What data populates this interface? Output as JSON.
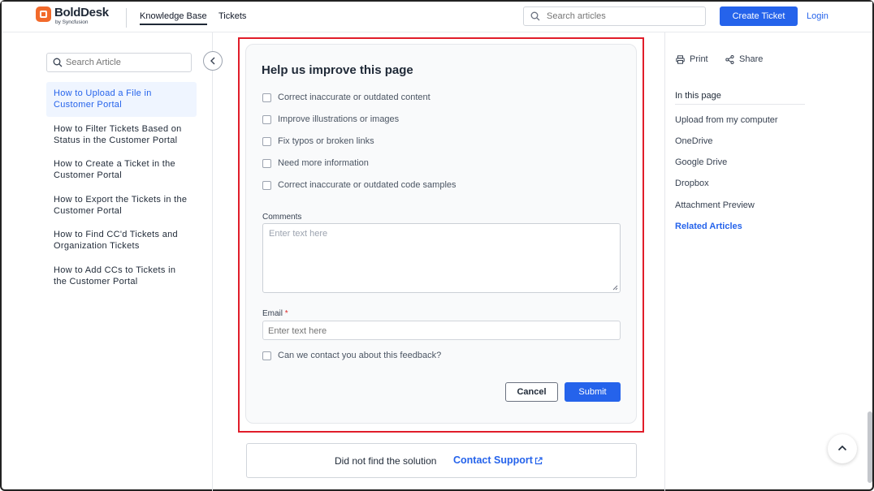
{
  "header": {
    "logo_text": "BoldDesk",
    "logo_subtext": "by Syncfusion",
    "nav": [
      {
        "label": "Knowledge Base",
        "active": true
      },
      {
        "label": "Tickets",
        "active": false
      }
    ],
    "search_placeholder": "Search articles",
    "create_ticket_label": "Create Ticket",
    "login_label": "Login"
  },
  "sidebar": {
    "search_placeholder": "Search Article",
    "items": [
      {
        "label": "How to Upload a File in Customer Portal",
        "active": true
      },
      {
        "label": "How to Filter Tickets Based on Status in the Customer Portal",
        "active": false
      },
      {
        "label": "How to Create a Ticket in the Customer Portal",
        "active": false
      },
      {
        "label": "How to Export the Tickets in the Customer Portal",
        "active": false
      },
      {
        "label": "How to Find CC'd Tickets and Organization Tickets",
        "active": false
      },
      {
        "label": "How to Add CCs to Tickets in the Customer Portal",
        "active": false
      }
    ]
  },
  "feedback": {
    "title": "Help us improve this page",
    "options": [
      "Correct inaccurate or outdated content",
      "Improve illustrations or images",
      "Fix typos or broken links",
      "Need more information",
      "Correct inaccurate or outdated code samples"
    ],
    "comments_label": "Comments",
    "comments_placeholder": "Enter text here",
    "email_label": "Email",
    "email_required_mark": "*",
    "email_placeholder": "Enter text here",
    "contact_consent": "Can we contact you about this feedback?",
    "cancel_label": "Cancel",
    "submit_label": "Submit"
  },
  "support": {
    "text": "Did not find the solution",
    "link": "Contact Support"
  },
  "right": {
    "print_label": "Print",
    "share_label": "Share",
    "toc_title": "In this page",
    "toc_items": [
      "Upload from my computer",
      "OneDrive",
      "Google Drive",
      "Dropbox",
      "Attachment Preview"
    ],
    "related_label": "Related Articles"
  },
  "colors": {
    "accent": "#2563eb",
    "brand": "#f26a2b",
    "highlight_frame": "#e11d2a"
  }
}
